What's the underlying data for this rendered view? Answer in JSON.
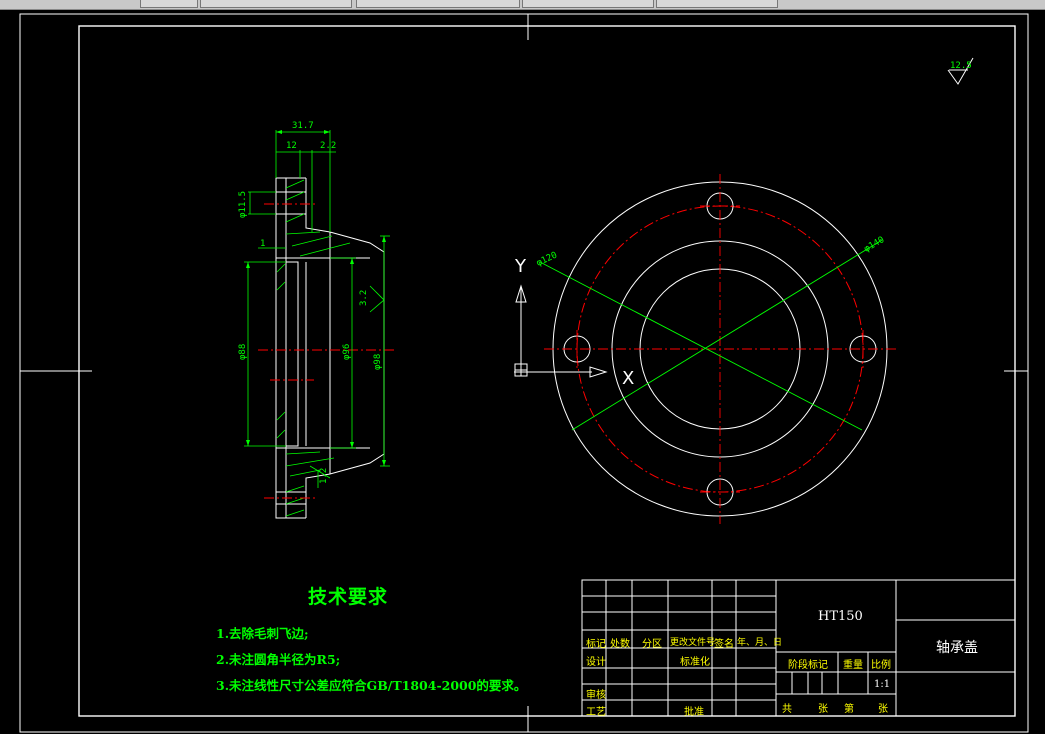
{
  "toolbar": {
    "buttons": [
      "",
      "",
      "",
      "",
      ""
    ]
  },
  "drawing": {
    "roughness_label": "12.5",
    "axis_y_label": "Y",
    "axis_x_label": "X",
    "side_view_dims": {
      "d_top_total": "31.7",
      "d_top_a": "12",
      "d_top_b": "2.2",
      "d_hole": "φ11.5",
      "d_small": "1",
      "d_taper": "3.2",
      "d_left_dia": "φ88",
      "d_mid_dia": "φ96",
      "d_right_dia": "φ98",
      "d_bottom": "1.2"
    },
    "front_view_dims": {
      "d_pcd": "φ120",
      "d_outer": "φ140"
    }
  },
  "tech_requirements": {
    "title": "技术要求",
    "items": [
      "1.去除毛刺飞边;",
      "2.未注圆角半径为R5;",
      "3.未注线性尺寸公差应符合GB/T1804-2000的要求。"
    ]
  },
  "title_block": {
    "material": "HT150",
    "part_name": "轴承盖",
    "scale": "1:1",
    "labels": {
      "mark": "标记",
      "count": "处数",
      "zone": "分区",
      "doc": "更改文件号",
      "sign": "签名",
      "date": "年、月、日",
      "design": "设计",
      "standard": "标准化",
      "stage": "阶段标记",
      "weight": "重量",
      "ratio": "比例",
      "review": "审核",
      "craft": "工艺",
      "approve": "批准",
      "total": "共",
      "sheet": "张",
      "nth": "第",
      "sheet2": "张"
    }
  }
}
